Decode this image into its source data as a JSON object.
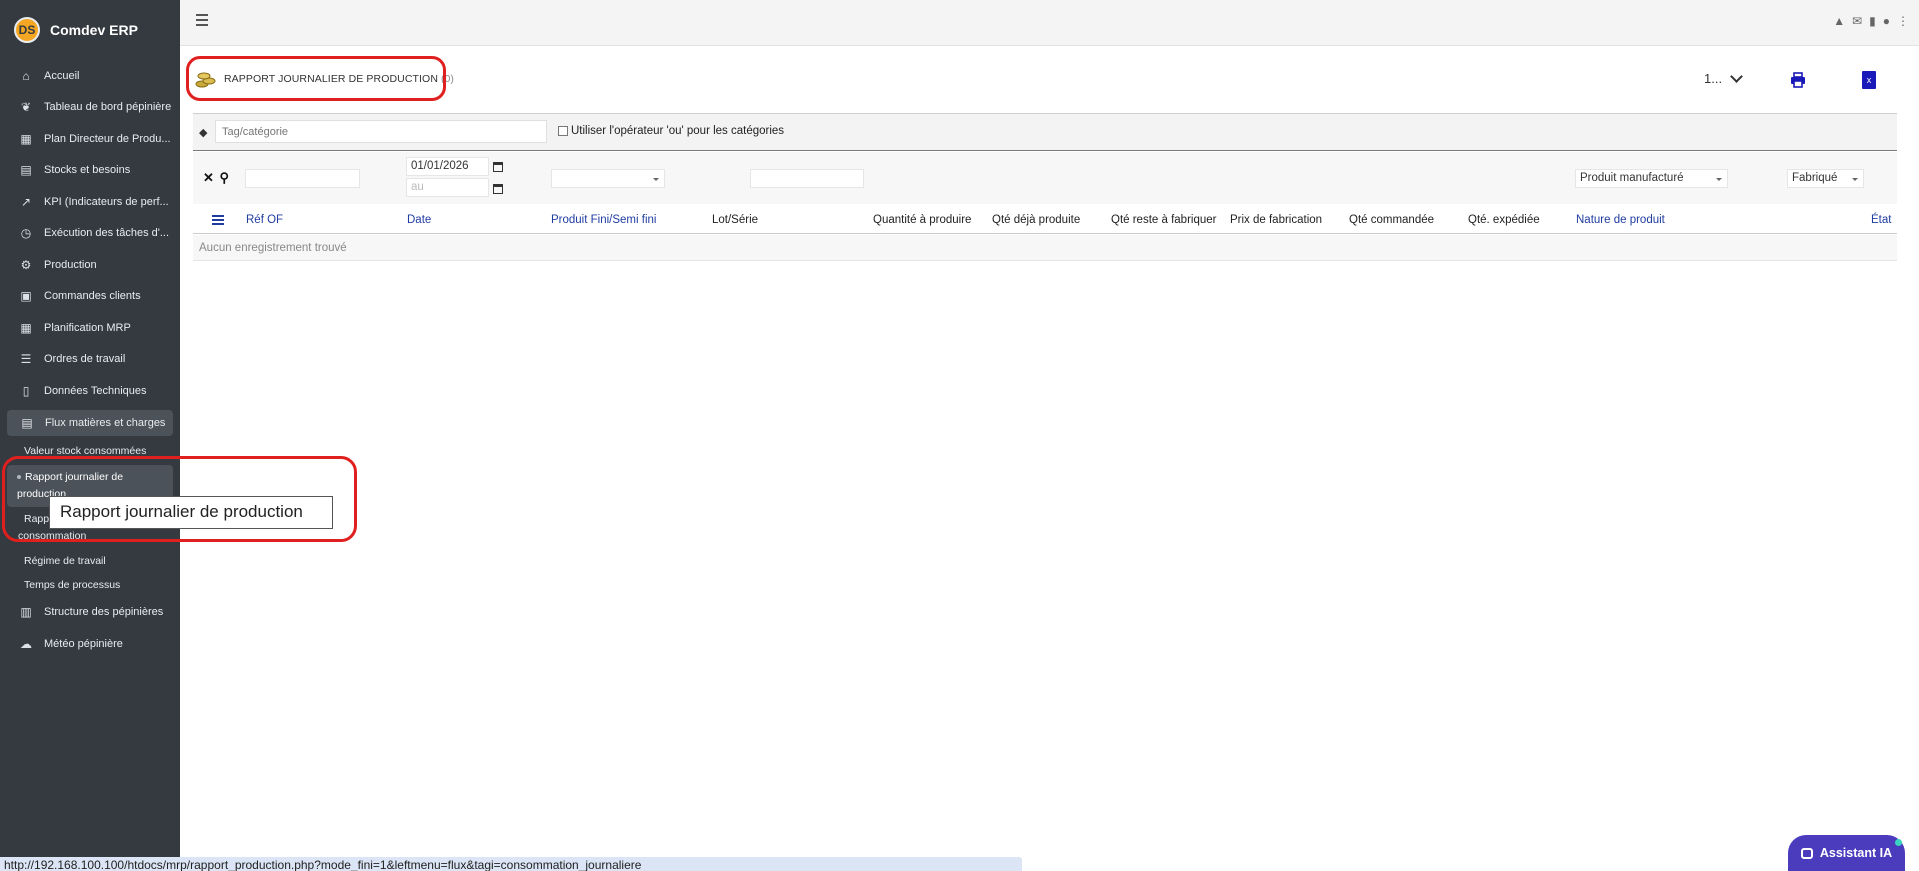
{
  "app": {
    "brand": "Comdev ERP",
    "logo_text": "DS"
  },
  "sidebar": {
    "items": [
      {
        "label": "Accueil",
        "icon": "home-icon"
      },
      {
        "label": "Tableau de bord pépinière",
        "icon": "leaf-icon"
      },
      {
        "label": "Plan Directeur de Produ...",
        "icon": "calendar-icon"
      },
      {
        "label": "Stocks et besoins",
        "icon": "boxes-icon"
      },
      {
        "label": "KPI (Indicateurs de perf...",
        "icon": "chart-line-icon"
      },
      {
        "label": "Exécution des tâches d'...",
        "icon": "clock-icon"
      },
      {
        "label": "Production",
        "icon": "gears-icon"
      },
      {
        "label": "Commandes clients",
        "icon": "file-icon"
      },
      {
        "label": "Planification MRP",
        "icon": "calendar-icon"
      },
      {
        "label": "Ordres de travail",
        "icon": "list-check-icon"
      },
      {
        "label": "Données Techniques",
        "icon": "document-icon"
      }
    ],
    "open_group": {
      "label": "Flux matières et charges",
      "icon": "boxes-icon"
    },
    "sub_items": {
      "valeur": "Valeur stock consommées",
      "rapport_journalier_1": "Rapport journalier de",
      "rapport_journalier_2": "production",
      "rapport_conso_1": "Rapp",
      "rapport_conso_2": "consommation",
      "regime": "Régime de travail",
      "temps": "Temps de processus"
    },
    "after_items": [
      {
        "label": "Structure des pépinières",
        "icon": "building-icon"
      },
      {
        "label": "Météo pépinière",
        "icon": "cloud-sun-icon"
      }
    ],
    "tooltip": "Rapport journalier de production"
  },
  "page": {
    "title": "RAPPORT JOURNALIER DE PRODUCTION",
    "count": "(0)",
    "pager": "1..."
  },
  "tagbar": {
    "placeholder": "Tag/catégorie",
    "checkbox_label": "Utiliser l'opérateur 'ou' pour les catégories"
  },
  "filters": {
    "date_from": "01/01/2026",
    "date_to_placeholder": "au",
    "nature_value": "Produit manufacturé",
    "etat_value": "Fabriqué"
  },
  "table": {
    "columns": [
      "Réf OF",
      "Date",
      "Produit Fini/Semi fini",
      "Lot/Série",
      "Quantité à produire",
      "Qté déjà produite",
      "Qté reste à fabriquer",
      "Prix de fabrication",
      "Qté commandée",
      "Qté. expédiée",
      "Nature de produit",
      "État"
    ],
    "empty_message": "Aucun enregistrement trouvé"
  },
  "status_url": "http://192.168.100.100/htdocs/mrp/rapport_production.php?mode_fini=1&leftmenu=flux&tagi=consommation_journaliere",
  "assistant": {
    "label": "Assistant IA"
  },
  "colors": {
    "sidebar_bg": "#343a40",
    "highlight": "#e0201f",
    "link": "#1f3ca0",
    "assistant": "#4b3bbd"
  }
}
